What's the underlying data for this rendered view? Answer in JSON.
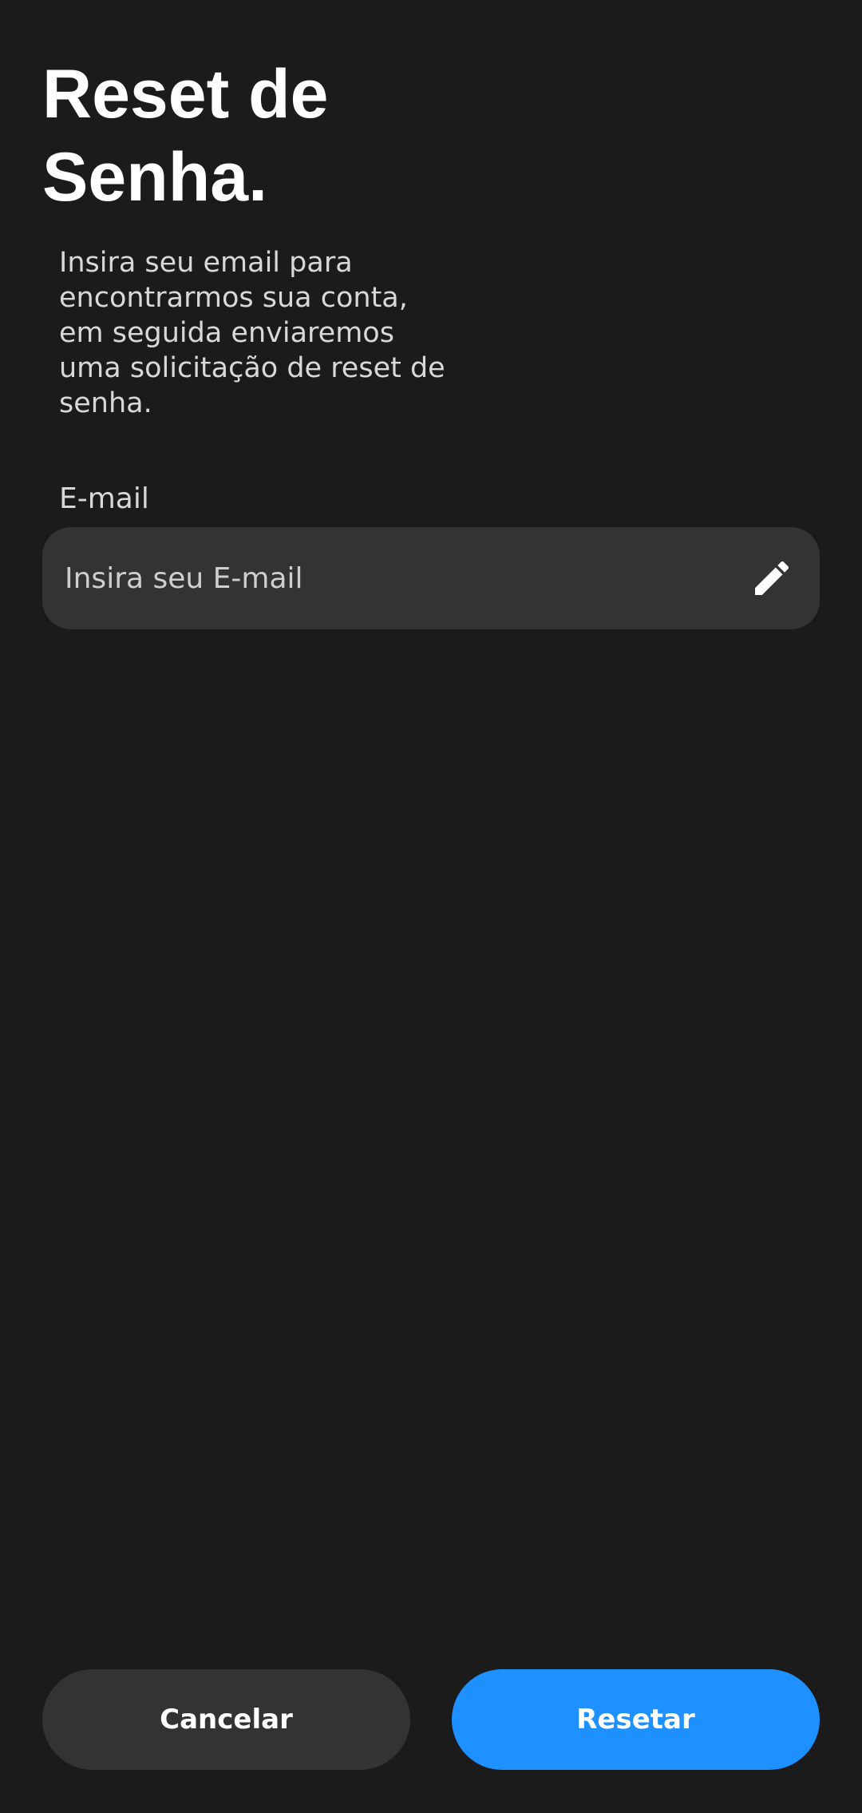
{
  "header": {
    "title": "Reset de\nSenha."
  },
  "description": "Insira seu email para encontrarmos sua conta, em seguida enviaremos uma solicitação de reset de senha.",
  "form": {
    "email_label": "E-mail",
    "email_value": "",
    "email_placeholder": "Insira seu E-mail",
    "edit_icon": "pencil-icon"
  },
  "actions": {
    "cancel_label": "Cancelar",
    "reset_label": "Resetar"
  },
  "colors": {
    "background": "#1b1b1b",
    "surface": "#333333",
    "accent": "#1e90ff"
  }
}
